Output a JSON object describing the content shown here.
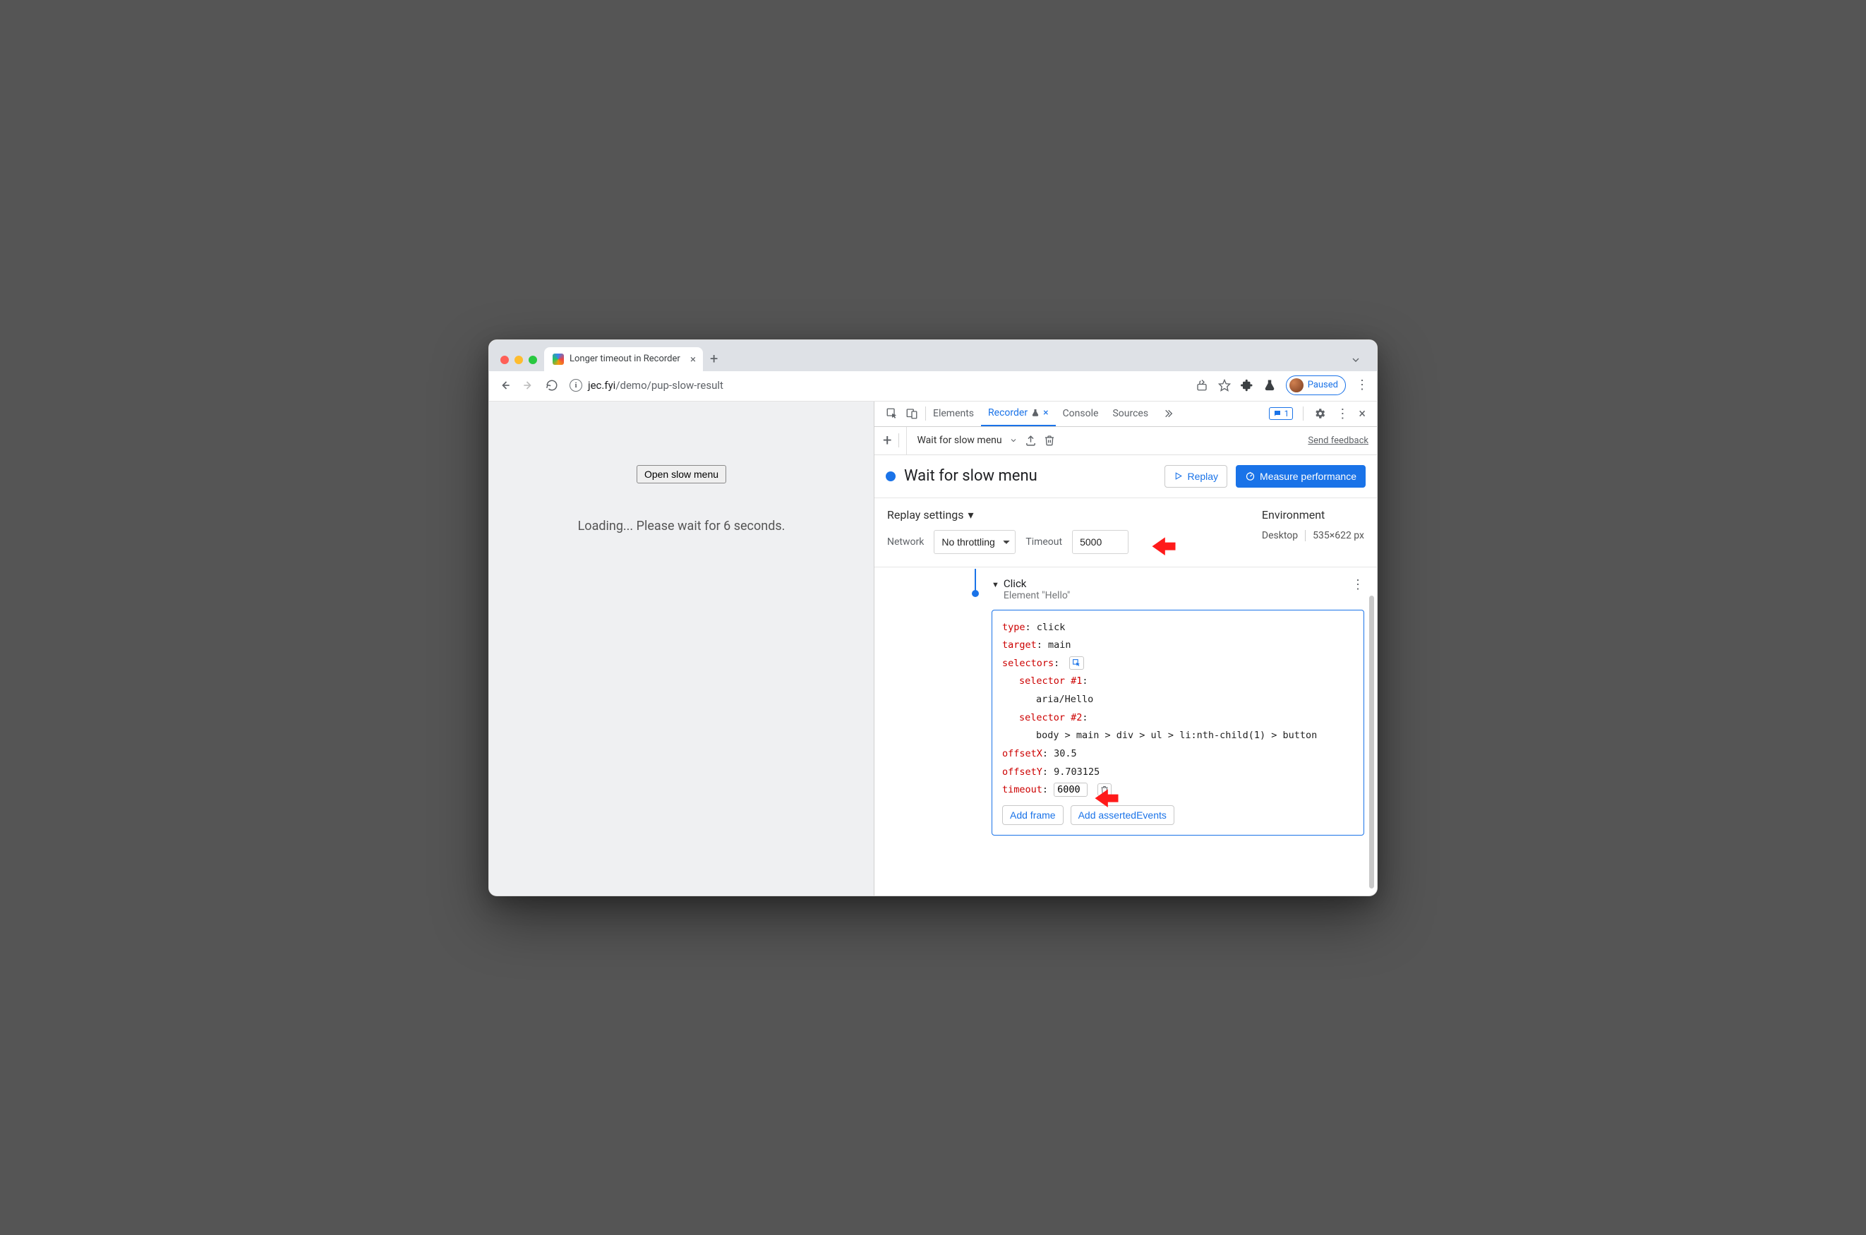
{
  "browser": {
    "tab_title": "Longer timeout in Recorder",
    "url_host": "jec.fyi",
    "url_path": "/demo/pup-slow-result",
    "paused_label": "Paused"
  },
  "page": {
    "open_button": "Open slow menu",
    "loading_text": "Loading... Please wait for 6 seconds."
  },
  "devtools": {
    "tabs": {
      "elements": "Elements",
      "recorder": "Recorder",
      "console": "Console",
      "sources": "Sources"
    },
    "issues_count": "1",
    "recorder": {
      "toolbar": {
        "recording_name": "Wait for slow menu",
        "send_feedback": "Send feedback"
      },
      "header": {
        "title": "Wait for slow menu",
        "replay": "Replay",
        "measure": "Measure performance"
      },
      "settings": {
        "title": "Replay settings",
        "network_label": "Network",
        "throttling_value": "No throttling",
        "timeout_label": "Timeout",
        "timeout_value": "5000",
        "env_title": "Environment",
        "env_device": "Desktop",
        "env_dims": "535×622 px"
      },
      "step": {
        "title": "Click",
        "subtitle": "Element \"Hello\"",
        "type_k": "type",
        "type_v": "click",
        "target_k": "target",
        "target_v": "main",
        "selectors_k": "selectors",
        "sel1_k": "selector #1",
        "sel1_v": "aria/Hello",
        "sel2_k": "selector #2",
        "sel2_v": "body > main > div > ul > li:nth-child(1) > button",
        "offx_k": "offsetX",
        "offx_v": "30.5",
        "offy_k": "offsetY",
        "offy_v": "9.703125",
        "timeout_k": "timeout",
        "timeout_v": "6000",
        "add_frame": "Add frame",
        "add_asserted": "Add assertedEvents"
      }
    }
  }
}
